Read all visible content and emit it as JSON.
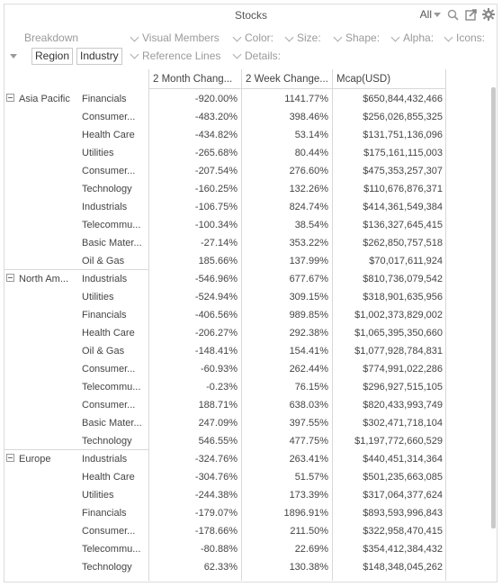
{
  "title": "Stocks",
  "filter": {
    "value": "All"
  },
  "icons": [
    "search-icon",
    "popout-icon",
    "gear-icon"
  ],
  "visual_members": {
    "breakdown_label": "Breakdown",
    "visual_members_label": "Visual Members",
    "color_label": "Color:",
    "size_label": "Size:",
    "shape_label": "Shape:",
    "alpha_label": "Alpha:",
    "icons_label": "Icons:",
    "reference_lines_label": "Reference Lines",
    "details_label": "Details:",
    "pills": [
      "Region",
      "Industry"
    ]
  },
  "columns": [
    "2 Month Chang...",
    "2 Week Change...",
    "Mcap(USD)"
  ],
  "regions": [
    {
      "name": "Asia Pacific",
      "rows": [
        {
          "industry": "Financials",
          "v1": "-920.00%",
          "v2": "1141.77%",
          "v3": "$650,844,432,466"
        },
        {
          "industry": "Consumer...",
          "v1": "-483.20%",
          "v2": "398.46%",
          "v3": "$256,026,855,325"
        },
        {
          "industry": "Health Care",
          "v1": "-434.82%",
          "v2": "53.14%",
          "v3": "$131,751,136,096"
        },
        {
          "industry": "Utilities",
          "v1": "-265.68%",
          "v2": "80.44%",
          "v3": "$175,161,115,003"
        },
        {
          "industry": "Consumer...",
          "v1": "-207.54%",
          "v2": "276.60%",
          "v3": "$475,353,257,307"
        },
        {
          "industry": "Technology",
          "v1": "-160.25%",
          "v2": "132.26%",
          "v3": "$110,676,876,371"
        },
        {
          "industry": "Industrials",
          "v1": "-106.75%",
          "v2": "824.74%",
          "v3": "$414,361,549,384"
        },
        {
          "industry": "Telecommu...",
          "v1": "-100.34%",
          "v2": "38.54%",
          "v3": "$136,327,645,415"
        },
        {
          "industry": "Basic Mater...",
          "v1": "-27.14%",
          "v2": "353.22%",
          "v3": "$262,850,757,518"
        },
        {
          "industry": "Oil & Gas",
          "v1": "185.66%",
          "v2": "137.99%",
          "v3": "$70,017,611,924"
        }
      ]
    },
    {
      "name": "North Am...",
      "rows": [
        {
          "industry": "Industrials",
          "v1": "-546.96%",
          "v2": "677.67%",
          "v3": "$810,736,079,542"
        },
        {
          "industry": "Utilities",
          "v1": "-524.94%",
          "v2": "309.15%",
          "v3": "$318,901,635,956"
        },
        {
          "industry": "Financials",
          "v1": "-406.56%",
          "v2": "989.85%",
          "v3": "$1,002,373,829,002"
        },
        {
          "industry": "Health Care",
          "v1": "-206.27%",
          "v2": "292.38%",
          "v3": "$1,065,395,350,660"
        },
        {
          "industry": "Oil & Gas",
          "v1": "-148.41%",
          "v2": "154.41%",
          "v3": "$1,077,928,784,831"
        },
        {
          "industry": "Consumer...",
          "v1": "-60.93%",
          "v2": "262.44%",
          "v3": "$774,991,022,286"
        },
        {
          "industry": "Telecommu...",
          "v1": "-0.23%",
          "v2": "76.15%",
          "v3": "$296,927,515,105"
        },
        {
          "industry": "Consumer...",
          "v1": "188.71%",
          "v2": "638.03%",
          "v3": "$820,433,993,749"
        },
        {
          "industry": "Basic Mater...",
          "v1": "247.09%",
          "v2": "397.55%",
          "v3": "$302,471,718,104"
        },
        {
          "industry": "Technology",
          "v1": "546.55%",
          "v2": "477.75%",
          "v3": "$1,197,772,660,529"
        }
      ]
    },
    {
      "name": "Europe",
      "rows": [
        {
          "industry": "Industrials",
          "v1": "-324.76%",
          "v2": "263.41%",
          "v3": "$440,451,314,364"
        },
        {
          "industry": "Health Care",
          "v1": "-304.76%",
          "v2": "51.57%",
          "v3": "$501,235,663,085"
        },
        {
          "industry": "Utilities",
          "v1": "-244.38%",
          "v2": "173.39%",
          "v3": "$317,064,377,624"
        },
        {
          "industry": "Financials",
          "v1": "-179.07%",
          "v2": "1896.91%",
          "v3": "$893,593,996,843"
        },
        {
          "industry": "Consumer...",
          "v1": "-178.66%",
          "v2": "211.50%",
          "v3": "$322,958,470,415"
        },
        {
          "industry": "Telecommu...",
          "v1": "-80.88%",
          "v2": "22.69%",
          "v3": "$354,412,384,432"
        },
        {
          "industry": "Technology",
          "v1": "62.33%",
          "v2": "130.38%",
          "v3": "$148,348,045,262"
        }
      ]
    }
  ]
}
